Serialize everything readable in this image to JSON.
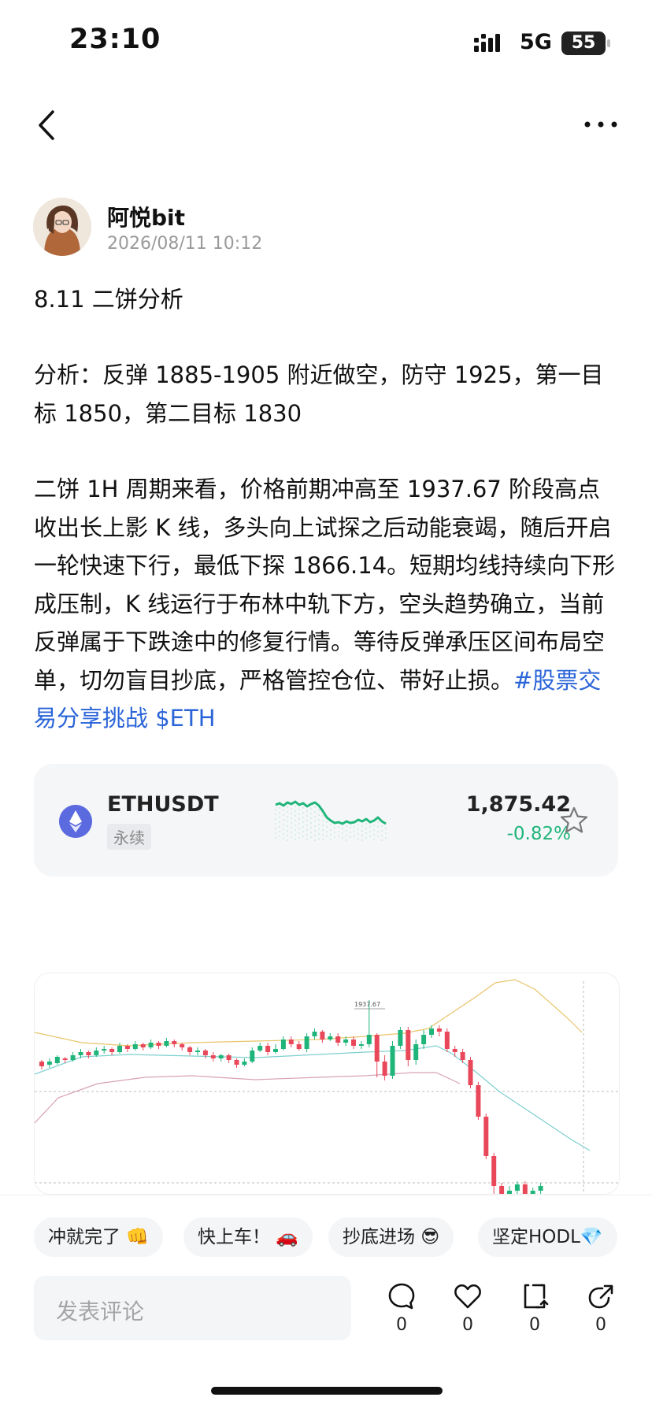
{
  "status_bar": {
    "time": "23:10",
    "network": "5G",
    "battery": "55"
  },
  "post": {
    "author": "阿悦bit",
    "timestamp": "2026/08/11 10:12",
    "title": "8.11 二饼分析",
    "analysis": "分析：反弹 1885-1905 附近做空，防守 1925，第一目标 1850，第二目标 1830",
    "body": "二饼 1H 周期来看，价格前期冲高至 1937.67 阶段高点收出长上影 K 线，多头向上试探之后动能衰竭，随后开启一轮快速下行，最低下探 1866.14。短期均线持续向下形成压制，K 线运行于布林中轨下方，空头趋势确立，当前反弹属于下跌途中的修复行情。等待反弹承压区间布局空单，切勿盲目抄底，严格管控仓位、带好止损。",
    "tags": "#股票交易分享挑战 $ETH"
  },
  "ticker": {
    "symbol": "ETHUSDT",
    "contract": "永续",
    "price": "1,875.42",
    "change": "-0.82%",
    "colors": {
      "up": "#1fb57a",
      "down": "#e8485a"
    }
  },
  "kline": {
    "high_label": "1937.67"
  },
  "quick_replies": [
    "冲就完了 👊",
    "快上车！ 🚗",
    "抄底进场 😎",
    "坚定HODL💎"
  ],
  "comment": {
    "placeholder": "发表评论"
  },
  "actions": [
    {
      "icon": "comment-icon",
      "count": "0"
    },
    {
      "icon": "like-icon",
      "count": "0"
    },
    {
      "icon": "repost-icon",
      "count": "0"
    },
    {
      "icon": "share-icon",
      "count": "0"
    }
  ]
}
